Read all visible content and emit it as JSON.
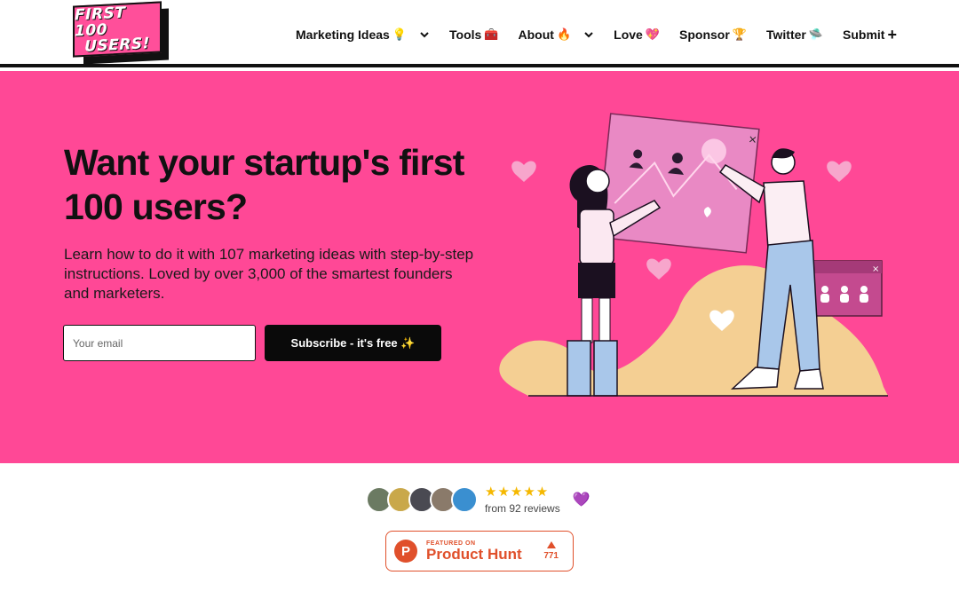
{
  "logo": {
    "line1": "FIRST 100",
    "line2": "USERS!"
  },
  "nav": {
    "items": [
      {
        "label": "Marketing Ideas",
        "emoji": "💡",
        "dropdown": true
      },
      {
        "label": "Tools",
        "emoji": "🧰",
        "dropdown": false
      },
      {
        "label": "About",
        "emoji": "🔥",
        "dropdown": true
      },
      {
        "label": "Love",
        "emoji": "💖",
        "dropdown": false
      },
      {
        "label": "Sponsor",
        "emoji": "🏆",
        "dropdown": false
      },
      {
        "label": "Twitter",
        "emoji": "🛸",
        "dropdown": false
      },
      {
        "label": "Submit",
        "emoji": "+",
        "dropdown": false
      }
    ]
  },
  "hero": {
    "title": "Want your startup's first 100 users?",
    "description": "Learn how to do it with 107 marketing ideas with step-by-step instructions. Loved by over 3,000 of the smartest founders and marketers.",
    "email_placeholder": "Your email",
    "subscribe_label": "Subscribe - it's free ✨"
  },
  "reviews": {
    "stars": "★★★★★",
    "count_text": "from 92 reviews",
    "heart": "💜"
  },
  "product_hunt": {
    "featured": "FEATURED ON",
    "name": "Product Hunt",
    "votes": "771",
    "logo_letter": "P"
  },
  "colors": {
    "hero_bg": "#ff4896",
    "accent_pink": "#ff4f9a",
    "button_bg": "#0a0a0a",
    "product_hunt": "#e0502b",
    "star": "#f5b800"
  }
}
